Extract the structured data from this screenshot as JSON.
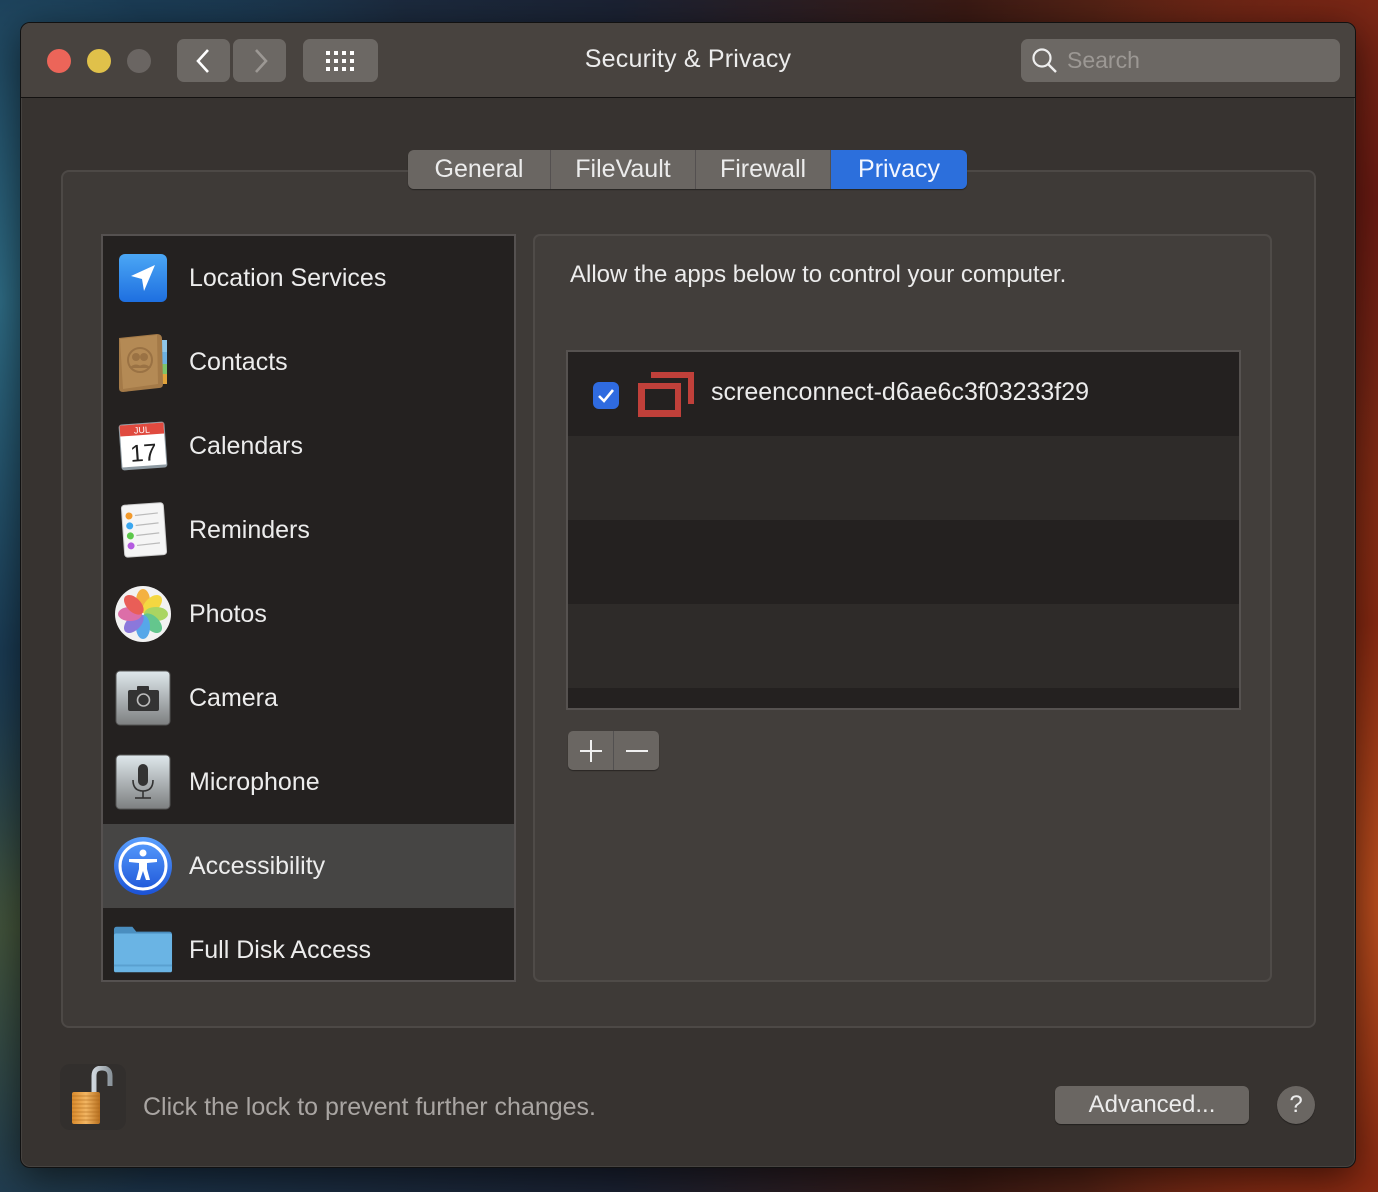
{
  "window": {
    "title": "Security & Privacy",
    "traffic_lights": {
      "close_color": "#ec6559",
      "minimize_color": "#e0c14a",
      "zoom_color": "#6a6562"
    },
    "nav": {
      "back_icon": "chevron-left-icon",
      "forward_icon": "chevron-right-icon",
      "grid_icon": "show-all-grid-icon"
    },
    "search": {
      "placeholder": "Search",
      "value": ""
    }
  },
  "tabs": [
    {
      "label": "General",
      "selected": false
    },
    {
      "label": "FileVault",
      "selected": false
    },
    {
      "label": "Firewall",
      "selected": false
    },
    {
      "label": "Privacy",
      "selected": true
    }
  ],
  "accent_color": "#2c6fdc",
  "sidebar": {
    "items": [
      {
        "label": "Location Services",
        "icon": "location-arrow-icon",
        "selected": false
      },
      {
        "label": "Contacts",
        "icon": "contacts-book-icon",
        "selected": false
      },
      {
        "label": "Calendars",
        "icon": "calendar-icon",
        "selected": false,
        "icon_month": "JUL",
        "icon_day": "17"
      },
      {
        "label": "Reminders",
        "icon": "reminders-list-icon",
        "selected": false
      },
      {
        "label": "Photos",
        "icon": "photos-flower-icon",
        "selected": false
      },
      {
        "label": "Camera",
        "icon": "camera-icon",
        "selected": false
      },
      {
        "label": "Microphone",
        "icon": "microphone-icon",
        "selected": false
      },
      {
        "label": "Accessibility",
        "icon": "accessibility-icon",
        "selected": true
      },
      {
        "label": "Full Disk Access",
        "icon": "folder-icon",
        "selected": false
      }
    ]
  },
  "content": {
    "description": "Allow the apps below to control your computer.",
    "apps": [
      {
        "name": "screenconnect-d6ae6c3f03233f29",
        "checked": true,
        "icon": "screenconnect-icon"
      }
    ],
    "add_label": "+",
    "remove_label": "−"
  },
  "footer": {
    "lock_text": "Click the lock to prevent further changes.",
    "lock_state": "unlocked",
    "advanced_label": "Advanced...",
    "help_label": "?"
  }
}
